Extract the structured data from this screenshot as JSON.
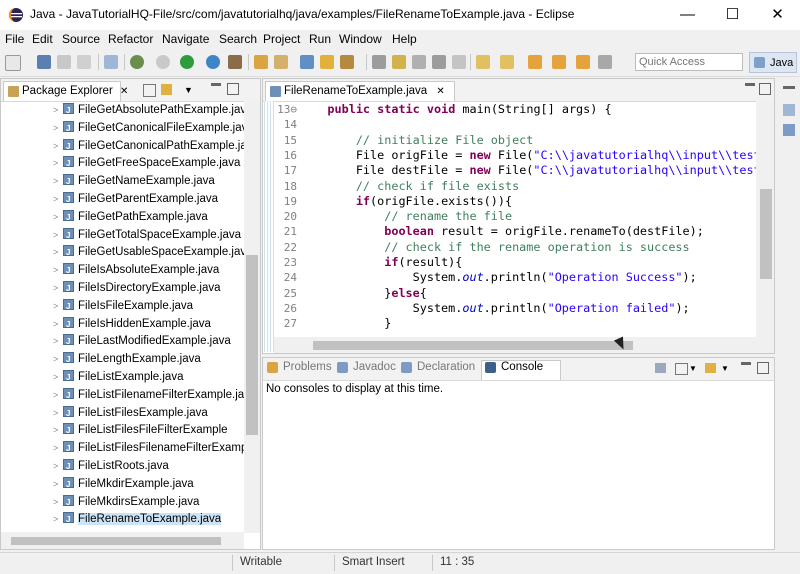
{
  "window": {
    "title": "Java - JavaTutorialHQ-File/src/com/javatutorialhq/java/examples/FileRenameToExample.java - Eclipse",
    "minimize": "—",
    "maximize": "☐",
    "close": "✕"
  },
  "menu": [
    "File",
    "Edit",
    "Source",
    "Refactor",
    "Navigate",
    "Search",
    "Project",
    "Run",
    "Window",
    "Help"
  ],
  "toolbar": {
    "quick_access_placeholder": "Quick Access",
    "perspective": "Java"
  },
  "package_explorer": {
    "title": "Package Explorer",
    "close": "✕",
    "files": [
      "FileGetAbsolutePathExample.java",
      "FileGetCanonicalFileExample.java",
      "FileGetCanonicalPathExample.java",
      "FileGetFreeSpaceExample.java",
      "FileGetNameExample.java",
      "FileGetParentExample.java",
      "FileGetPathExample.java",
      "FileGetTotalSpaceExample.java",
      "FileGetUsableSpaceExample.java",
      "FileIsAbsoluteExample.java",
      "FileIsDirectoryExample.java",
      "FileIsFileExample.java",
      "FileIsHiddenExample.java",
      "FileLastModifiedExample.java",
      "FileLengthExample.java",
      "FileListExample.java",
      "FileListFilenameFilterExample.java",
      "FileListFilesExample.java",
      "FileListFilesFileFilterExample",
      "FileListFilesFilenameFilterExamp",
      "FileListRoots.java",
      "FileMkdirExample.java",
      "FileMkdirsExample.java",
      "FileRenameToExample.java"
    ],
    "selected_index": 23
  },
  "editor": {
    "tab_label": "FileRenameToExample.java",
    "close": "✕",
    "line_numbers": [
      "13⊖",
      "14",
      "15",
      "16",
      "17",
      "18",
      "19",
      "20",
      "21",
      "22",
      "23",
      "24",
      "25",
      "26",
      "27"
    ]
  },
  "console_view": {
    "tabs": [
      "Problems",
      "Javadoc",
      "Declaration",
      "Console"
    ],
    "active_tab": "Console",
    "message": "No consoles to display at this time."
  },
  "status_bar": {
    "mode": "Writable",
    "insert_mode": "Smart Insert",
    "position": "11 : 35"
  },
  "colors": {
    "keyword": "#7f0055",
    "comment": "#3f7f5f",
    "string": "#2a00ff",
    "field": "#0000c0",
    "selection": "#cde4f7"
  }
}
